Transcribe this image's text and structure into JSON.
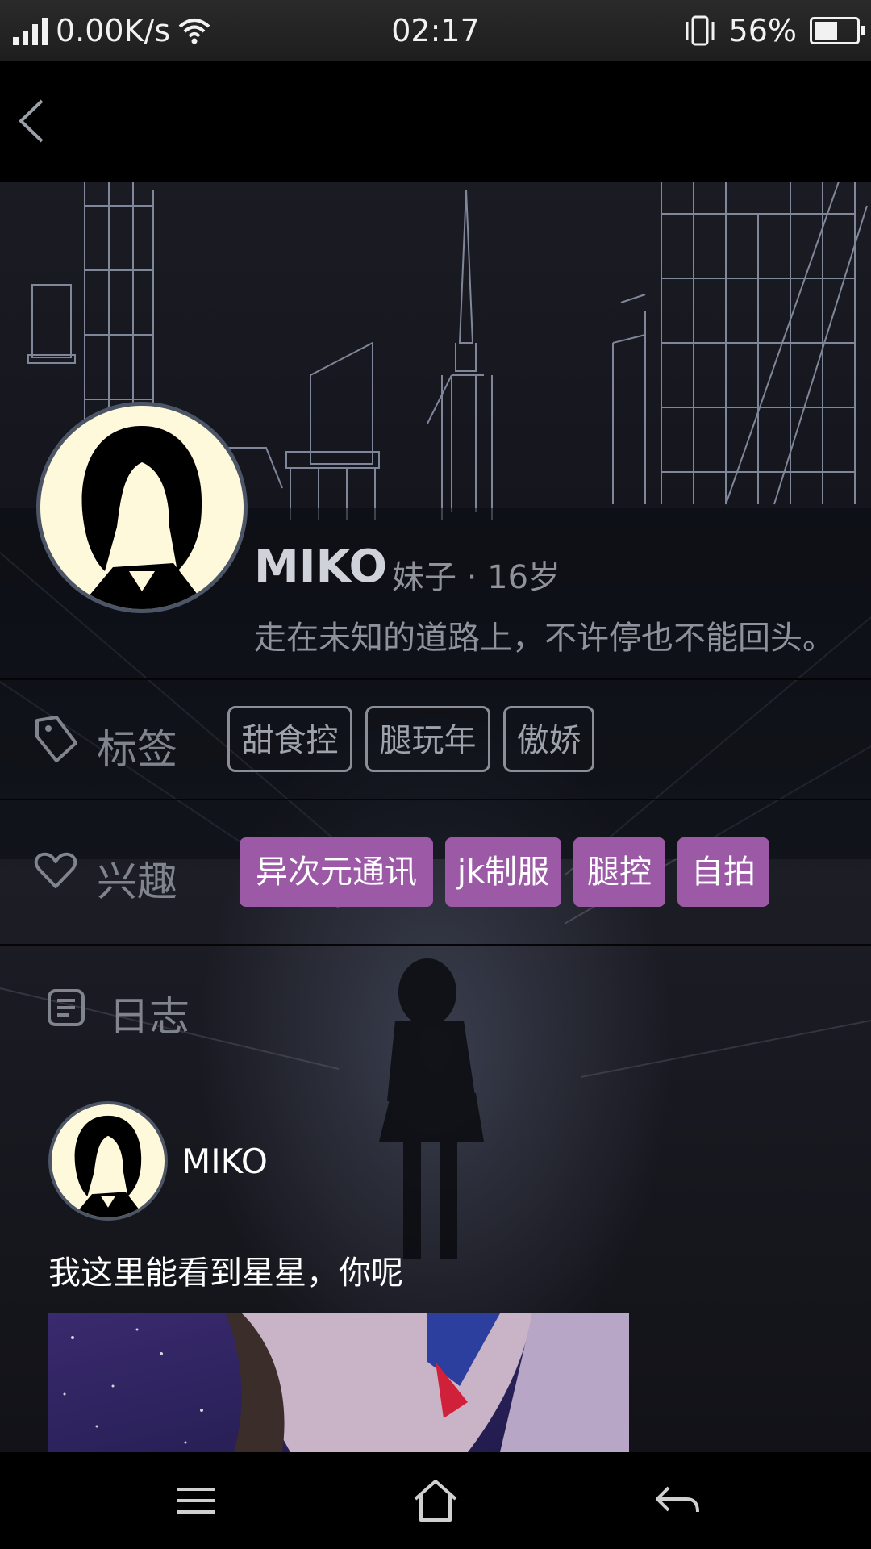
{
  "status_bar": {
    "network_speed": "0.00K/s",
    "time": "02:17",
    "battery_percent": "56%",
    "battery_level": 0.56
  },
  "profile": {
    "name": "MIKO",
    "meta": "妹子 · 16岁",
    "bio": "走在未知的道路上，不许停也不能回头。"
  },
  "tags_section": {
    "label": "标签",
    "tags": [
      "甜食控",
      "腿玩年",
      "傲娇"
    ]
  },
  "interests_section": {
    "label": "兴趣",
    "interests": [
      "异次元通讯",
      "jk制服",
      "腿控",
      "自拍"
    ],
    "accent_color": "#9b59a6"
  },
  "journal_section": {
    "label": "日志",
    "post": {
      "author": "MIKO",
      "text": "我这里能看到星星，你呢"
    }
  },
  "icons": {
    "back": "back-arrow-icon",
    "tag": "tag-icon",
    "heart": "heart-icon",
    "journal": "journal-icon",
    "menu": "menu-icon",
    "home": "home-icon",
    "return": "return-icon"
  }
}
